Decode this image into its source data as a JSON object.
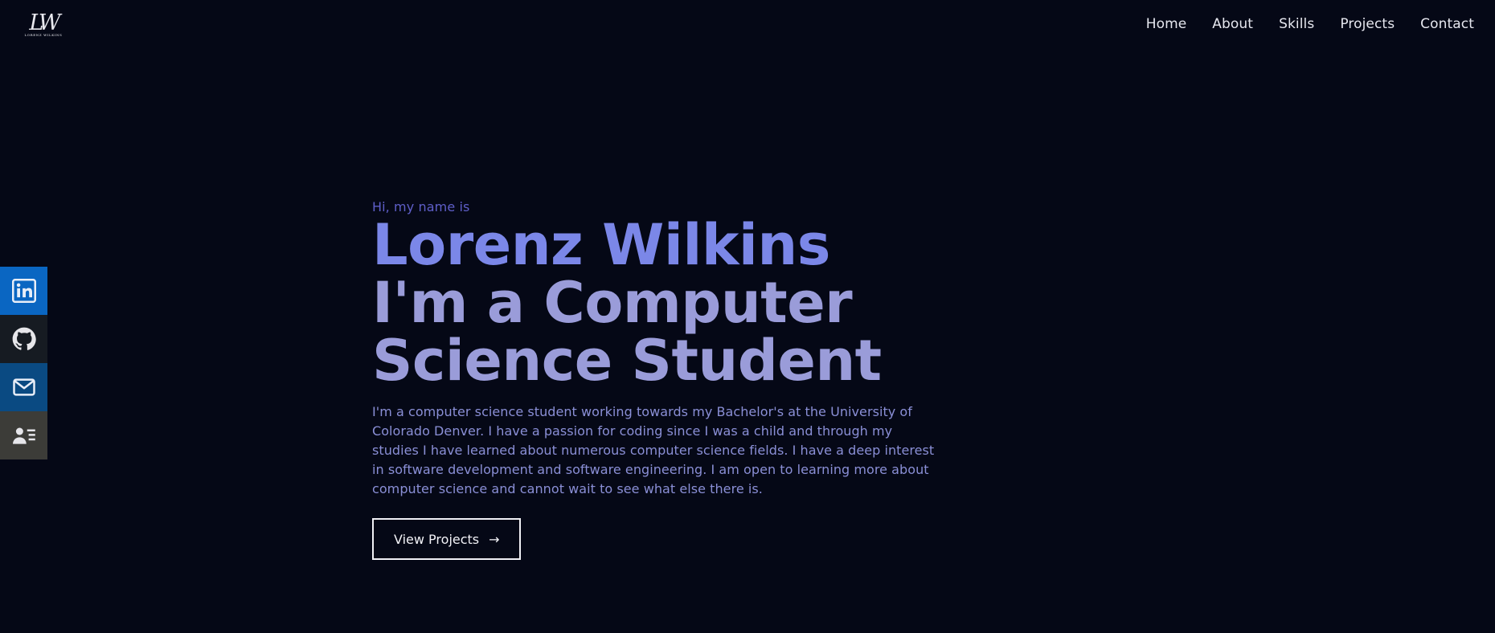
{
  "header": {
    "logo": {
      "mark": "LW",
      "sub": "LORENZ WILKINS"
    },
    "nav": [
      {
        "label": "Home"
      },
      {
        "label": "About"
      },
      {
        "label": "Skills"
      },
      {
        "label": "Projects"
      },
      {
        "label": "Contact"
      }
    ]
  },
  "social": [
    {
      "name": "linkedin",
      "icon": "linkedin-icon",
      "color": "#0a66c2"
    },
    {
      "name": "github",
      "icon": "github-icon",
      "color": "#161b22"
    },
    {
      "name": "email",
      "icon": "mail-icon",
      "color": "#0a4a82"
    },
    {
      "name": "resume",
      "icon": "contact-card-icon",
      "color": "#3c3c38"
    }
  ],
  "hero": {
    "greeting": "Hi, my name is",
    "name": "Lorenz Wilkins",
    "role": "I'm a Computer Science Student",
    "description": "I'm a computer science student working towards my Bachelor's at the University of Colorado Denver. I have a passion for coding since I was a child and through my studies I have learned about numerous computer science fields. I have a deep interest in software development and software engineering. I am open to learning more about computer science and cannot wait to see what else there is.",
    "cta_label": "View Projects",
    "cta_arrow": "→"
  },
  "colors": {
    "background": "#050816",
    "name": "#7b87e8",
    "role": "#9a9cd9",
    "body": "#8a8fd6"
  }
}
